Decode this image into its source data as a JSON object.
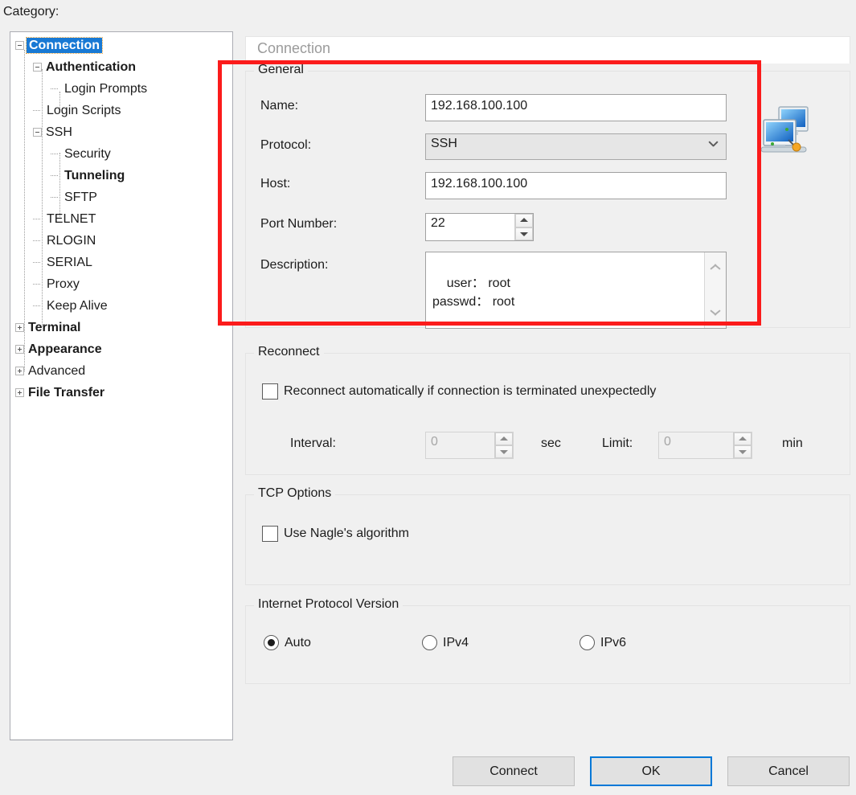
{
  "category": {
    "label": "Category:",
    "items": [
      {
        "label": "Connection",
        "indent": 0,
        "toggle": "minus",
        "bold": true,
        "selected": true
      },
      {
        "label": "Authentication",
        "indent": 1,
        "toggle": "minus",
        "bold": true,
        "selected": false
      },
      {
        "label": "Login Prompts",
        "indent": 2,
        "toggle": "none",
        "bold": false,
        "selected": false
      },
      {
        "label": "Login Scripts",
        "indent": 1,
        "toggle": "none",
        "bold": false,
        "selected": false
      },
      {
        "label": "SSH",
        "indent": 1,
        "toggle": "minus",
        "bold": false,
        "selected": false
      },
      {
        "label": "Security",
        "indent": 2,
        "toggle": "none",
        "bold": false,
        "selected": false
      },
      {
        "label": "Tunneling",
        "indent": 2,
        "toggle": "none",
        "bold": true,
        "selected": false
      },
      {
        "label": "SFTP",
        "indent": 2,
        "toggle": "none",
        "bold": false,
        "selected": false
      },
      {
        "label": "TELNET",
        "indent": 1,
        "toggle": "none",
        "bold": false,
        "selected": false
      },
      {
        "label": "RLOGIN",
        "indent": 1,
        "toggle": "none",
        "bold": false,
        "selected": false
      },
      {
        "label": "SERIAL",
        "indent": 1,
        "toggle": "none",
        "bold": false,
        "selected": false
      },
      {
        "label": "Proxy",
        "indent": 1,
        "toggle": "none",
        "bold": false,
        "selected": false
      },
      {
        "label": "Keep Alive",
        "indent": 1,
        "toggle": "none",
        "bold": false,
        "selected": false
      },
      {
        "label": "Terminal",
        "indent": 0,
        "toggle": "plus",
        "bold": true,
        "selected": false
      },
      {
        "label": "Appearance",
        "indent": 0,
        "toggle": "plus",
        "bold": true,
        "selected": false
      },
      {
        "label": "Advanced",
        "indent": 0,
        "toggle": "plus",
        "bold": false,
        "selected": false
      },
      {
        "label": "File Transfer",
        "indent": 0,
        "toggle": "plus",
        "bold": true,
        "selected": false
      }
    ]
  },
  "content": {
    "header_title": "Connection",
    "general": {
      "title": "General",
      "name_label": "Name:",
      "name_value": "192.168.100.100",
      "protocol_label": "Protocol:",
      "protocol_value": "SSH",
      "host_label": "Host:",
      "host_value": "192.168.100.100",
      "port_label": "Port Number:",
      "port_value": "22",
      "description_label": "Description:",
      "description_value": "user： root\npasswd： root"
    },
    "reconnect": {
      "title": "Reconnect",
      "auto_reconnect_label": "Reconnect automatically if connection is terminated unexpectedly",
      "auto_reconnect_checked": false,
      "interval_label": "Interval:",
      "interval_value": "0",
      "interval_unit": "sec",
      "limit_label": "Limit:",
      "limit_value": "0",
      "limit_unit": "min"
    },
    "tcp_options": {
      "title": "TCP Options",
      "nagle_label": "Use Nagle's algorithm",
      "nagle_checked": false
    },
    "ip_version": {
      "title": "Internet Protocol Version",
      "options": [
        {
          "label": "Auto",
          "checked": true
        },
        {
          "label": "IPv4",
          "checked": false
        },
        {
          "label": "IPv6",
          "checked": false
        }
      ]
    }
  },
  "footer": {
    "connect_label": "Connect",
    "ok_label": "OK",
    "cancel_label": "Cancel"
  },
  "colors": {
    "selection_blue": "#1879d4",
    "highlight_red": "#fb1b1b",
    "default_button_border": "#0078d7",
    "window_bg": "#f0f0f0"
  }
}
